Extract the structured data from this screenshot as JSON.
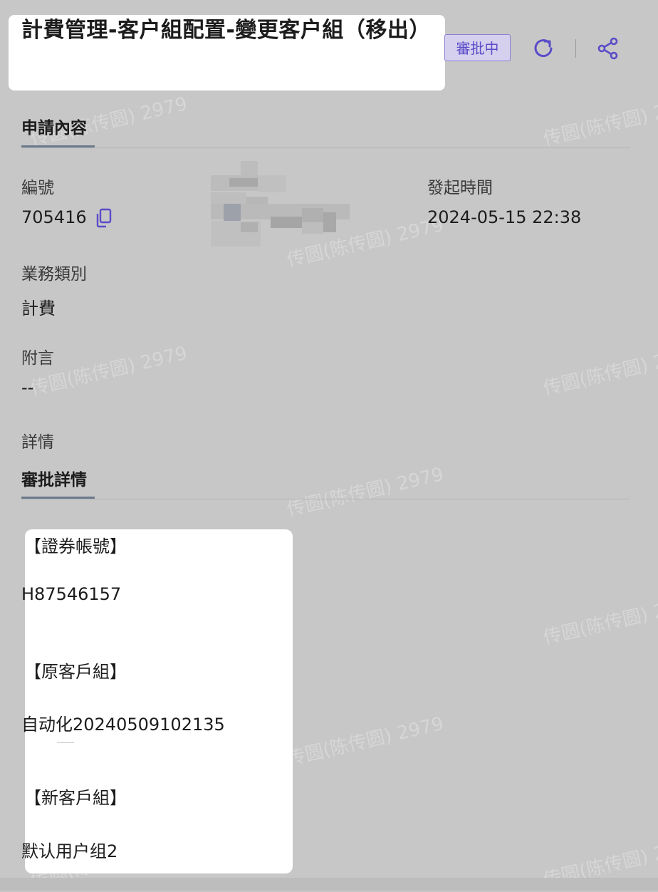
{
  "header": {
    "title": "計費管理-客户組配置-變更客户組（移出）",
    "status_badge": "審批中",
    "refresh_icon": "refresh-icon",
    "share_icon": "share-icon"
  },
  "application": {
    "section_title": "申請內容",
    "id_label": "編號",
    "id_value": "705416",
    "copy_icon": "copy-icon",
    "time_label": "發起時間",
    "time_value": "2024-05-15 22:38",
    "business_label": "業務類別",
    "business_value": "計費",
    "remark_label": "附言",
    "remark_value": "--",
    "details_label": "詳情"
  },
  "approval": {
    "section_title": "審批詳情",
    "account_heading": "【證券帳號】",
    "account_value": "H87546157",
    "old_group_heading": "【原客戶組】",
    "old_group_value": "自动化20240509102135",
    "new_group_heading": "【新客戶組】",
    "new_group_value": "默认用户组2"
  },
  "watermark": "传圆(陈传圆) 2979",
  "colors": {
    "background": "#c7c7c7",
    "accent": "#5a4cc8",
    "badge_bg": "#d6d0ef"
  }
}
